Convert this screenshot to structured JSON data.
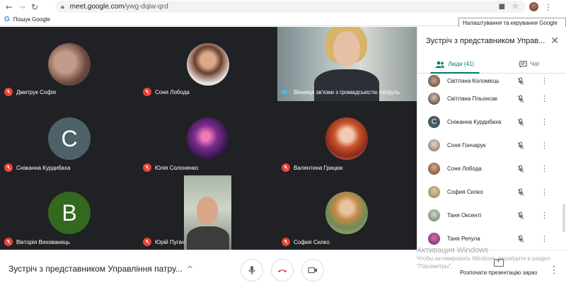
{
  "browser": {
    "url_host": "meet.google.com",
    "url_path": "/ywg-dqiw-qrd",
    "bookmark_label": "Пошук Google",
    "bookmark_logo": "G",
    "tooltip": "Налаштування та керування Google Chrome"
  },
  "tiles": [
    {
      "name": "Дмитрук Софія"
    },
    {
      "name": "Соня Лобода"
    },
    {
      "name": "Вінниця зв'язки з громадськістю патруль"
    },
    {
      "name": "Сніжанна Курдибаха",
      "letter": "С"
    },
    {
      "name": "Юлія Солоненко"
    },
    {
      "name": "Валентина Грицюк"
    },
    {
      "name": "Вікторія Вихованець",
      "letter": "В"
    },
    {
      "name": "Юрій Пугач"
    },
    {
      "name": "София Силко"
    }
  ],
  "bottom": {
    "meeting_title": "Зустріч з представником Управління патру...",
    "present_label": "Розпочати презентацію зараз",
    "watermark_title": "Активация Windows",
    "watermark_text": "Чтобы активировать Windows, перейдите в раздел \"Параметры\"."
  },
  "panel": {
    "title": "Зустріч з представником Управ...",
    "tab_people": "Люди (41)",
    "tab_chat": "Чат",
    "accent_color": "#00796b",
    "people": [
      {
        "name": "Світлана Коломієць"
      },
      {
        "name": "Світлана Пльонсак"
      },
      {
        "name": "Сніжанна Курдибаха",
        "letter": "С"
      },
      {
        "name": "Соня Гончарук"
      },
      {
        "name": "Соня Лобода"
      },
      {
        "name": "София Силко"
      },
      {
        "name": "Таня Оксенті"
      },
      {
        "name": "Таня Репула"
      }
    ]
  },
  "colors": {
    "grid_background": "#202124",
    "mic_off": "#ea4335",
    "end_call": "#d93025"
  }
}
